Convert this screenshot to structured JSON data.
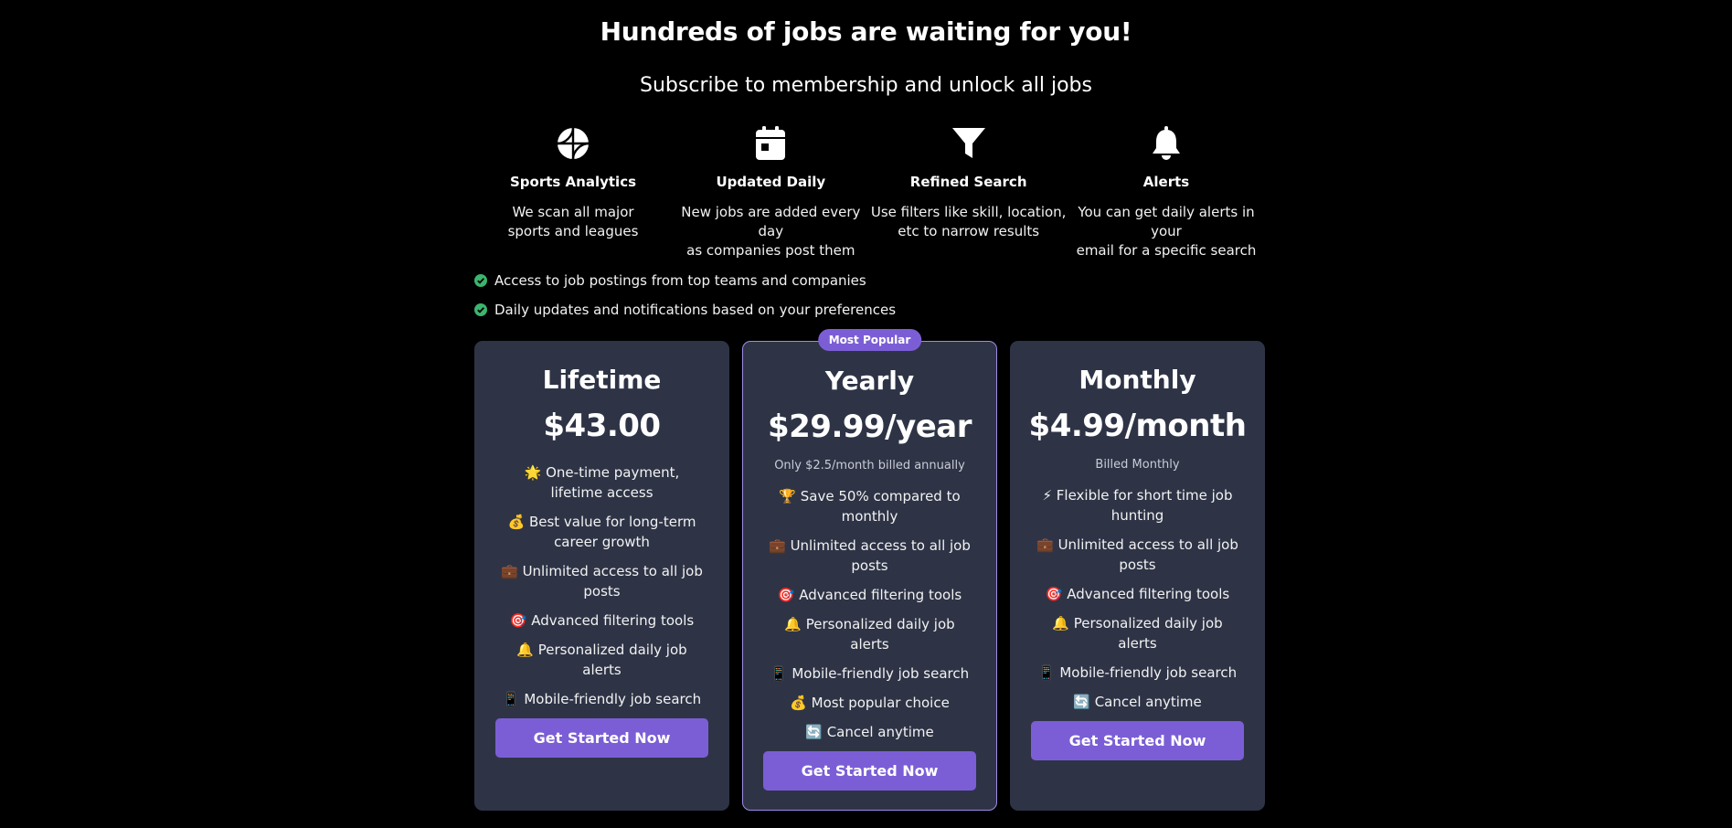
{
  "header": {
    "title": "Hundreds of jobs are waiting for you!",
    "subtitle": "Subscribe to membership and unlock all jobs"
  },
  "features": [
    {
      "icon": "basketball-icon",
      "title": "Sports Analytics",
      "desc_line1": "We scan all major",
      "desc_line2": "sports and leagues"
    },
    {
      "icon": "calendar-icon",
      "title": "Updated Daily",
      "desc_line1": "New jobs are added every day",
      "desc_line2": "as companies post them"
    },
    {
      "icon": "filter-icon",
      "title": "Refined Search",
      "desc_line1": "Use filters like skill, location,",
      "desc_line2": "etc to narrow results"
    },
    {
      "icon": "bell-icon",
      "title": "Alerts",
      "desc_line1": "You can get daily alerts in your",
      "desc_line2": "email for a specific search"
    }
  ],
  "benefits": [
    "Access to job postings from top teams and companies",
    "Daily updates and notifications based on your preferences"
  ],
  "colors": {
    "accent": "#7b5ed6",
    "card_bg": "#2e3446",
    "check_green": "#3cb46e",
    "page_bg": "#000000"
  },
  "plans": [
    {
      "name": "Lifetime",
      "price": "$43.00",
      "note": "",
      "items": [
        "🌟 One-time payment, lifetime access",
        "💰 Best value for long-term career growth",
        "💼 Unlimited access to all job posts",
        "🎯 Advanced filtering tools",
        "🔔 Personalized daily job alerts",
        "📱 Mobile-friendly job search"
      ],
      "cta": "Get Started Now"
    },
    {
      "name": "Yearly",
      "badge": "Most Popular",
      "price": "$29.99/year",
      "note": "Only $2.5/month billed annually",
      "items": [
        "🏆 Save 50% compared to monthly",
        "💼 Unlimited access to all job posts",
        "🎯 Advanced filtering tools",
        "🔔 Personalized daily job alerts",
        "📱 Mobile-friendly job search",
        "💰 Most popular choice",
        "🔄 Cancel anytime"
      ],
      "cta": "Get Started Now"
    },
    {
      "name": "Monthly",
      "price": "$4.99/month",
      "note": "Billed Monthly",
      "items": [
        "⚡ Flexible for short time job hunting",
        "💼 Unlimited access to all job posts",
        "🎯 Advanced filtering tools",
        "🔔 Personalized daily job alerts",
        "📱 Mobile-friendly job search",
        "🔄 Cancel anytime"
      ],
      "cta": "Get Started Now"
    }
  ]
}
